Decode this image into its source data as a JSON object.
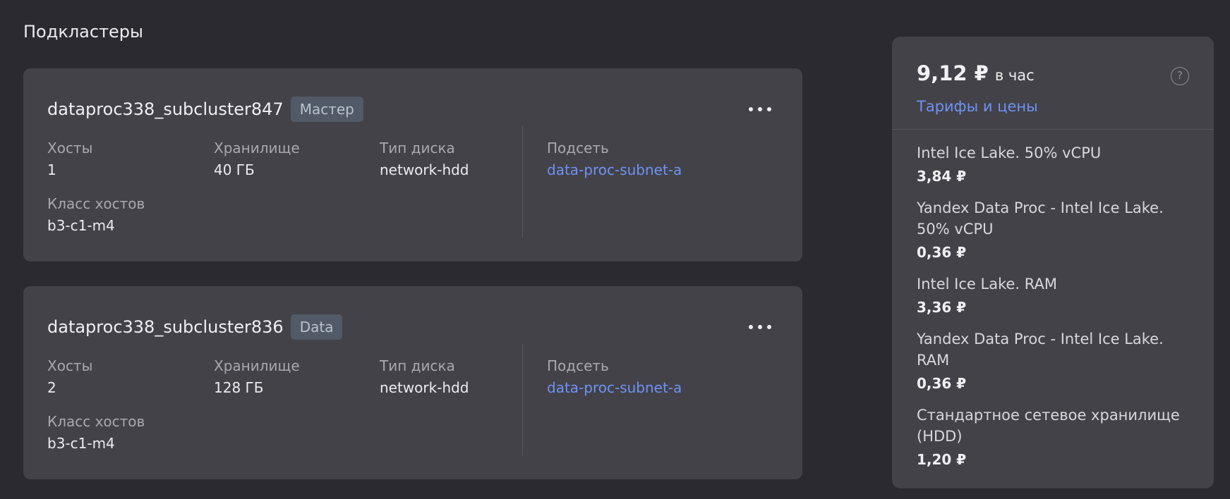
{
  "section_title": "Подкластеры",
  "subclusters": [
    {
      "name": "dataproc338_subcluster847",
      "role": "Мастер",
      "hosts_label": "Хосты",
      "hosts": "1",
      "storage_label": "Хранилище",
      "storage": "40 ГБ",
      "disk_label": "Тип диска",
      "disk": "network-hdd",
      "subnet_label": "Подсеть",
      "subnet": "data-proc-subnet-a",
      "class_label": "Класс хостов",
      "class": "b3-c1-m4"
    },
    {
      "name": "dataproc338_subcluster836",
      "role": "Data",
      "hosts_label": "Хосты",
      "hosts": "2",
      "storage_label": "Хранилище",
      "storage": "128 ГБ",
      "disk_label": "Тип диска",
      "disk": "network-hdd",
      "subnet_label": "Подсеть",
      "subnet": "data-proc-subnet-a",
      "class_label": "Класс хостов",
      "class": "b3-c1-m4"
    }
  ],
  "pricing": {
    "total": "9,12 ₽",
    "unit": "в час",
    "help_icon": "?",
    "tariffs_link": "Тарифы и цены",
    "items": [
      {
        "name": "Intel Ice Lake. 50% vCPU",
        "cost": "3,84 ₽"
      },
      {
        "name": "Yandex Data Proc - Intel Ice Lake. 50% vCPU",
        "cost": "0,36 ₽"
      },
      {
        "name": "Intel Ice Lake. RAM",
        "cost": "3,36 ₽"
      },
      {
        "name": "Yandex Data Proc - Intel Ice Lake. RAM",
        "cost": "0,36 ₽"
      },
      {
        "name": "Стандартное сетевое хранилище (HDD)",
        "cost": "1,20 ₽"
      }
    ]
  },
  "colors": {
    "background": "#2b2a30",
    "card": "#434249",
    "link": "#6e93f2",
    "badge_bg": "#515a66"
  }
}
